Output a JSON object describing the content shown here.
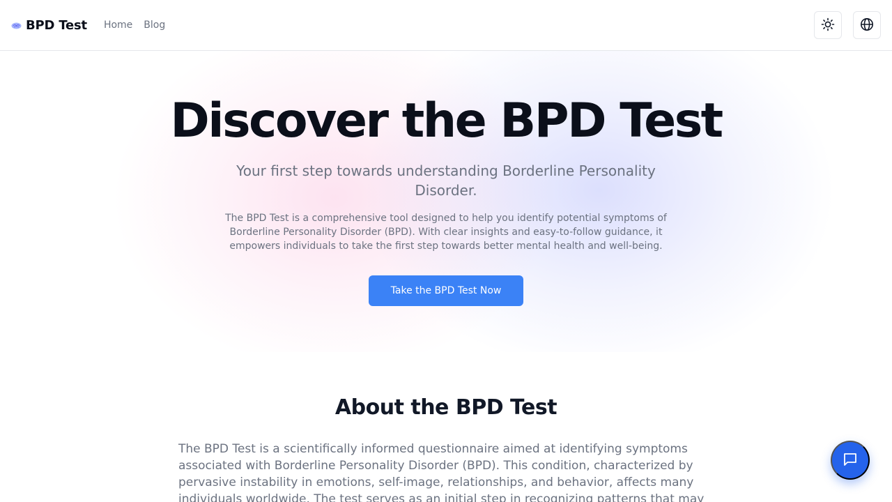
{
  "header": {
    "brand_icon": "brain-icon",
    "brand": "BPD Test",
    "nav": [
      {
        "label": "Home"
      },
      {
        "label": "Blog"
      }
    ],
    "actions": [
      {
        "icon": "sun-icon"
      },
      {
        "icon": "globe-icon"
      }
    ]
  },
  "hero": {
    "title": "Discover the BPD Test",
    "subtitle": "Your first step towards understanding Borderline Personality Disorder.",
    "description": "The BPD Test is a comprehensive tool designed to help you identify potential symptoms of Borderline Personality Disorder (BPD). With clear insights and easy-to-follow guidance, it empowers individuals to take the first step towards better mental health and well-being.",
    "cta_label": "Take the BPD Test Now"
  },
  "about": {
    "title": "About the BPD Test",
    "text": "The BPD Test is a scientifically informed questionnaire aimed at identifying symptoms associated with Borderline Personality Disorder (BPD). This condition, characterized by pervasive instability in emotions, self-image, relationships, and behavior, affects many individuals worldwide. The test serves as an initial step in recognizing patterns that may align with BPD, enabling individuals to"
  },
  "chat": {
    "icon": "chat-bubble-icon"
  },
  "colors": {
    "accent": "#3b82f6",
    "chat": "#2563eb",
    "muted_text": "#6b7280",
    "heading": "#0b0f1a"
  }
}
